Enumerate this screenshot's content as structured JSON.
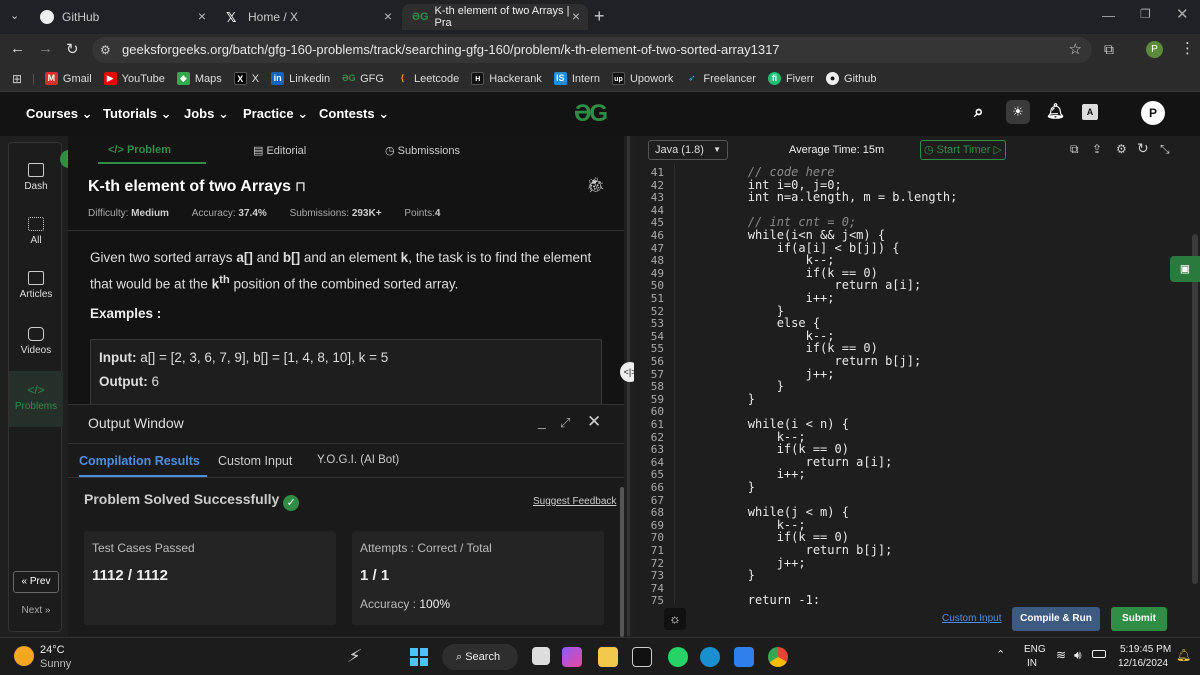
{
  "browser": {
    "tabs": [
      {
        "label": "GitHub"
      },
      {
        "label": "Home / X"
      },
      {
        "label": "K-th element of two Arrays | Pra"
      }
    ],
    "url": "geeksforgeeks.org/batch/gfg-160-problems/track/searching-gfg-160/problem/k-th-element-of-two-sorted-array1317",
    "bookmarks": [
      "Gmail",
      "YouTube",
      "Maps",
      "X",
      "Linkedin",
      "GFG",
      "Leetcode",
      "Hackerank",
      "Intern",
      "Upowork",
      "Freelancer",
      "Fiverr",
      "Github"
    ],
    "profile_initial": "P"
  },
  "nav": {
    "items": [
      "Courses",
      "Tutorials",
      "Jobs",
      "Practice",
      "Contests"
    ],
    "profile_initial": "P"
  },
  "rail": {
    "items": [
      "Dash",
      "All",
      "Articles",
      "Videos",
      "Problems"
    ],
    "prev": "« Prev",
    "next": "Next »"
  },
  "problem": {
    "tabs": [
      "</> Problem",
      "Editorial",
      "Submissions"
    ],
    "title": "K-th element of two Arrays",
    "difficulty_label": "Difficulty:",
    "difficulty": "Medium",
    "accuracy_label": "Accuracy:",
    "accuracy": "37.4%",
    "submissions_label": "Submissions:",
    "submissions": "293K+",
    "points_label": "Points:",
    "points": "4",
    "desc_1": "Given two sorted arrays ",
    "desc_a": "a[]",
    "desc_2": " and ",
    "desc_b": "b[]",
    "desc_3": " and an element ",
    "desc_k": "k",
    "desc_4": ", the task is to find the element",
    "desc_5": "that would be at the ",
    "desc_kth": "k",
    "desc_th": "th",
    "desc_6": " position of the combined sorted array.",
    "examples": "Examples :",
    "input_label": "Input:",
    "input_value": " a[] = [2, 3, 6, 7, 9], b[] = [1, 4, 8, 10], k = 5",
    "output_label": "Output:",
    "output_value": " 6"
  },
  "output_window": {
    "title": "Output Window",
    "tabs": [
      "Compilation Results",
      "Custom Input",
      "Y.O.G.I. (AI Bot)"
    ],
    "status": "Problem Solved Successfully",
    "feedback": "Suggest Feedback",
    "tc_label": "Test Cases Passed",
    "tc_value": "1112 / 1112",
    "attempts_label": "Attempts : Correct / Total",
    "attempts_value": "1 / 1",
    "accuracy_label": "Accuracy :",
    "accuracy_value": "100%"
  },
  "editor": {
    "language": "Java (1.8)",
    "avg_time": "Average Time: 15m",
    "start_timer": "Start Timer",
    "lines": [
      {
        "n": "41",
        "t": "        // code here"
      },
      {
        "n": "42",
        "t": "        int i=0, j=0;"
      },
      {
        "n": "43",
        "t": "        int n=a.length, m = b.length;"
      },
      {
        "n": "44",
        "t": ""
      },
      {
        "n": "45",
        "t": "        // int cnt = 0;"
      },
      {
        "n": "46",
        "t": "        while(i<n && j<m) {"
      },
      {
        "n": "47",
        "t": "            if(a[i] < b[j]) {"
      },
      {
        "n": "48",
        "t": "                k--;"
      },
      {
        "n": "49",
        "t": "                if(k == 0)"
      },
      {
        "n": "50",
        "t": "                    return a[i];"
      },
      {
        "n": "51",
        "t": "                i++;"
      },
      {
        "n": "52",
        "t": "            }"
      },
      {
        "n": "53",
        "t": "            else {"
      },
      {
        "n": "54",
        "t": "                k--;"
      },
      {
        "n": "55",
        "t": "                if(k == 0)"
      },
      {
        "n": "56",
        "t": "                    return b[j];"
      },
      {
        "n": "57",
        "t": "                j++;"
      },
      {
        "n": "58",
        "t": "            }"
      },
      {
        "n": "59",
        "t": "        }"
      },
      {
        "n": "60",
        "t": ""
      },
      {
        "n": "61",
        "t": "        while(i < n) {"
      },
      {
        "n": "62",
        "t": "            k--;"
      },
      {
        "n": "63",
        "t": "            if(k == 0)"
      },
      {
        "n": "64",
        "t": "                return a[i];"
      },
      {
        "n": "65",
        "t": "            i++;"
      },
      {
        "n": "66",
        "t": "        }"
      },
      {
        "n": "67",
        "t": ""
      },
      {
        "n": "68",
        "t": "        while(j < m) {"
      },
      {
        "n": "69",
        "t": "            k--;"
      },
      {
        "n": "70",
        "t": "            if(k == 0)"
      },
      {
        "n": "71",
        "t": "                return b[j];"
      },
      {
        "n": "72",
        "t": "            j++;"
      },
      {
        "n": "73",
        "t": "        }"
      },
      {
        "n": "74",
        "t": ""
      },
      {
        "n": "75",
        "t": "        return -1;"
      }
    ],
    "custom_input": "Custom Input",
    "compile_run": "Compile & Run",
    "submit": "Submit"
  },
  "taskbar": {
    "temp": "24°C",
    "weather": "Sunny",
    "search": "Search",
    "lang_1": "ENG",
    "lang_2": "IN",
    "time": "5:19:45 PM",
    "date": "12/16/2024"
  },
  "colors": {
    "gfg_green": "#2f8d46",
    "submit_green": "#2f8d46",
    "compile_blue": "#3d5a80"
  }
}
